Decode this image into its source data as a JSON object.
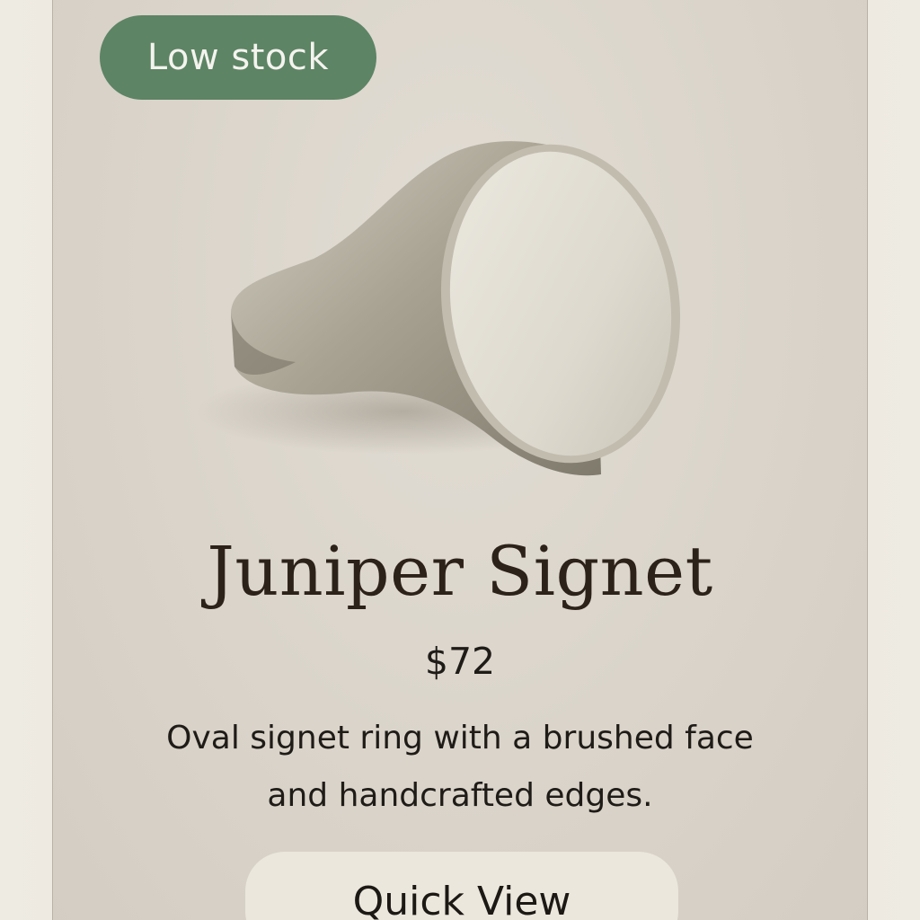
{
  "product_card": {
    "badge": "Low stock",
    "image_icon": "oval-signet-ring-photo",
    "title": "Juniper Signet",
    "price": "$72",
    "description": "Oval signet ring with a brushed face and handcrafted edges.",
    "quick_view_label": "Quick View"
  },
  "colors": {
    "badge_bg": "#5d8464",
    "card_bg": "#d9d3c9",
    "button_bg": "#ebe7dd",
    "title_text": "#2c2219"
  }
}
